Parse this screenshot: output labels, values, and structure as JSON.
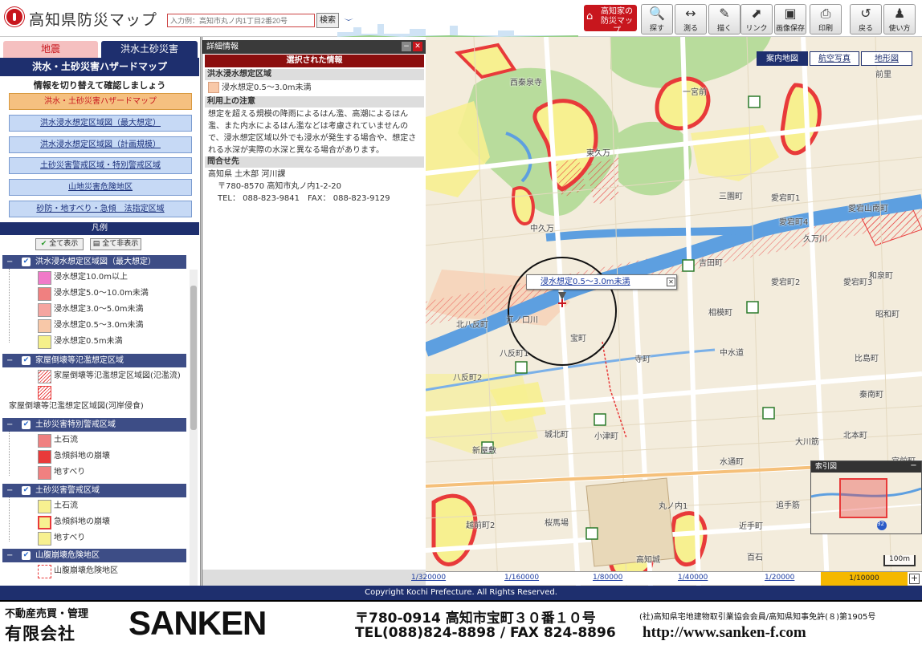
{
  "header": {
    "title": "高知県防災マップ",
    "search_placeholder": "入力例：高知市丸ノ内1丁目2番20号",
    "search_button": "検索",
    "home_button": "高知家の防災マップ",
    "tools": [
      {
        "icon": "search-icon",
        "label": "探す",
        "glyph": "🔍"
      },
      {
        "icon": "measure-icon",
        "label": "測る",
        "glyph": "↔"
      },
      {
        "icon": "draw-icon",
        "label": "描く",
        "glyph": "✎"
      },
      {
        "icon": "link-icon",
        "label": "リンク",
        "glyph": "⬈"
      },
      {
        "icon": "save-image-icon",
        "label": "画像保存",
        "glyph": "▣"
      },
      {
        "icon": "print-icon",
        "label": "印刷",
        "glyph": "⎙"
      },
      {
        "icon": "back-icon",
        "label": "戻る",
        "glyph": "↺"
      },
      {
        "icon": "help-icon",
        "label": "使い方",
        "glyph": "♟"
      }
    ]
  },
  "left": {
    "tab_earthquake": "地震",
    "tab_flood": "洪水土砂災害",
    "map_title": "洪水・土砂災害ハザードマップ",
    "switch_hint": "情報を切り替えて確認しましょう",
    "map_buttons": [
      "洪水・土砂災害ハザードマップ",
      "洪水浸水想定区域図（最大想定）",
      "洪水浸水想定区域図（計画規模）",
      "土砂災害警戒区域・特別警戒区域",
      "山地災害危険地区",
      "砂防・地すべり・急傾　法指定区域"
    ],
    "legend_title": "凡例",
    "show_all": "全て表示",
    "hide_all": "全て非表示",
    "legend": {
      "flood_head": "洪水浸水想定区域図（最大想定）",
      "flood": [
        {
          "label": "浸水想定10.0m以上",
          "color": "#f07ac8"
        },
        {
          "label": "浸水想定5.0〜10.0m未満",
          "color": "#f08080"
        },
        {
          "label": "浸水想定3.0〜5.0m未満",
          "color": "#f5a5a0"
        },
        {
          "label": "浸水想定0.5〜3.0m未満",
          "color": "#f8c8a8"
        },
        {
          "label": "浸水想定0.5m未満",
          "color": "#f5f08a"
        }
      ],
      "house_head": "家屋倒壊等氾濫想定区域",
      "house_flow": "家屋倒壊等氾濫想定区域図(氾濫流)",
      "house_erosion": "家屋倒壊等氾濫想定区域図(河岸侵食)",
      "special_head": "土砂災害特別警戒区域",
      "special": [
        {
          "label": "土石流",
          "color": "#f08080"
        },
        {
          "label": "急傾斜地の崩壊",
          "color": "#e83a3a"
        },
        {
          "label": "地すべり",
          "color": "#f08080"
        }
      ],
      "warn_head": "土砂災害警戒区域",
      "warn": [
        {
          "label": "土石流",
          "color": "#f7f090"
        },
        {
          "label": "急傾斜地の崩壊",
          "color": "#f7f090"
        },
        {
          "label": "地すべり",
          "color": "#f7f090"
        }
      ],
      "mountain_head": "山腹崩壊危険地区",
      "mountain": "山腹崩壊危険地区"
    }
  },
  "detail": {
    "header": "詳細情報",
    "selected_head": "選択された情報",
    "sec_area": "洪水浸水想定区域",
    "area_value": "浸水想定0.5〜3.0m未満",
    "area_color": "#f8c8a8",
    "sec_notes": "利用上の注意",
    "notes": "想定を超える規模の降雨によるはん濫、高潮によるはん濫、また内水によるはん濫などは考慮されていませんので、浸水想定区域以外でも浸水が発生する場合や、想定される水深が実際の水深と異なる場合があります。",
    "sec_contact": "問合せ先",
    "contact_org": "高知県 土木部 河川課",
    "contact_addr": "〒780-8570 高知市丸ノ内1-2-20",
    "contact_tel": "TEL： 088-823-9841　FAX： 088-823-9129"
  },
  "map": {
    "base_tabs": [
      "案内地図",
      "航空写真",
      "地形図"
    ],
    "popup": "浸水想定0.5〜3.0m未満",
    "popup_close": "✕",
    "labels": [
      "西秦泉寺",
      "東久万",
      "中久万",
      "久万川",
      "江ノ口川",
      "前里",
      "三園町",
      "愛宕町1",
      "愛宕町2",
      "愛宕町3",
      "愛宕町4",
      "愛宕山南町",
      "一宮前",
      "和泉町",
      "吉田町",
      "昭和町",
      "相模町",
      "北八反町",
      "宝町",
      "八反町1",
      "八反町2",
      "寺町",
      "中水道",
      "城北町",
      "小津町",
      "新屋敷",
      "大川筋",
      "水通町",
      "北本町",
      "秦南町",
      "比島町",
      "桜馬場",
      "越前町2",
      "丸ノ内1",
      "近手町",
      "追手筋",
      "宮前町",
      "高知城",
      "百石"
    ],
    "index_title": "索引図",
    "index_badge": "32",
    "scale_bar": "100m",
    "scales": [
      "1/320000",
      "1/160000",
      "1/80000",
      "1/40000",
      "1/20000"
    ],
    "scale_current": "1/10000"
  },
  "copyright": "Copyright Kochi Prefecture. All Rights Reserved.",
  "banner": {
    "trade": "不動産売買・管理",
    "company": "有限会社",
    "brand": "SANKEN",
    "address": "〒780-0914 高知市宝町３０番１０号",
    "tel": "TEL(088)824-8898 / FAX 824-8896",
    "assoc": "(社)高知県宅地建物取引業協会会員/高知県知事免許(８)第1905号",
    "url": "http://www.sanken-f.com"
  }
}
